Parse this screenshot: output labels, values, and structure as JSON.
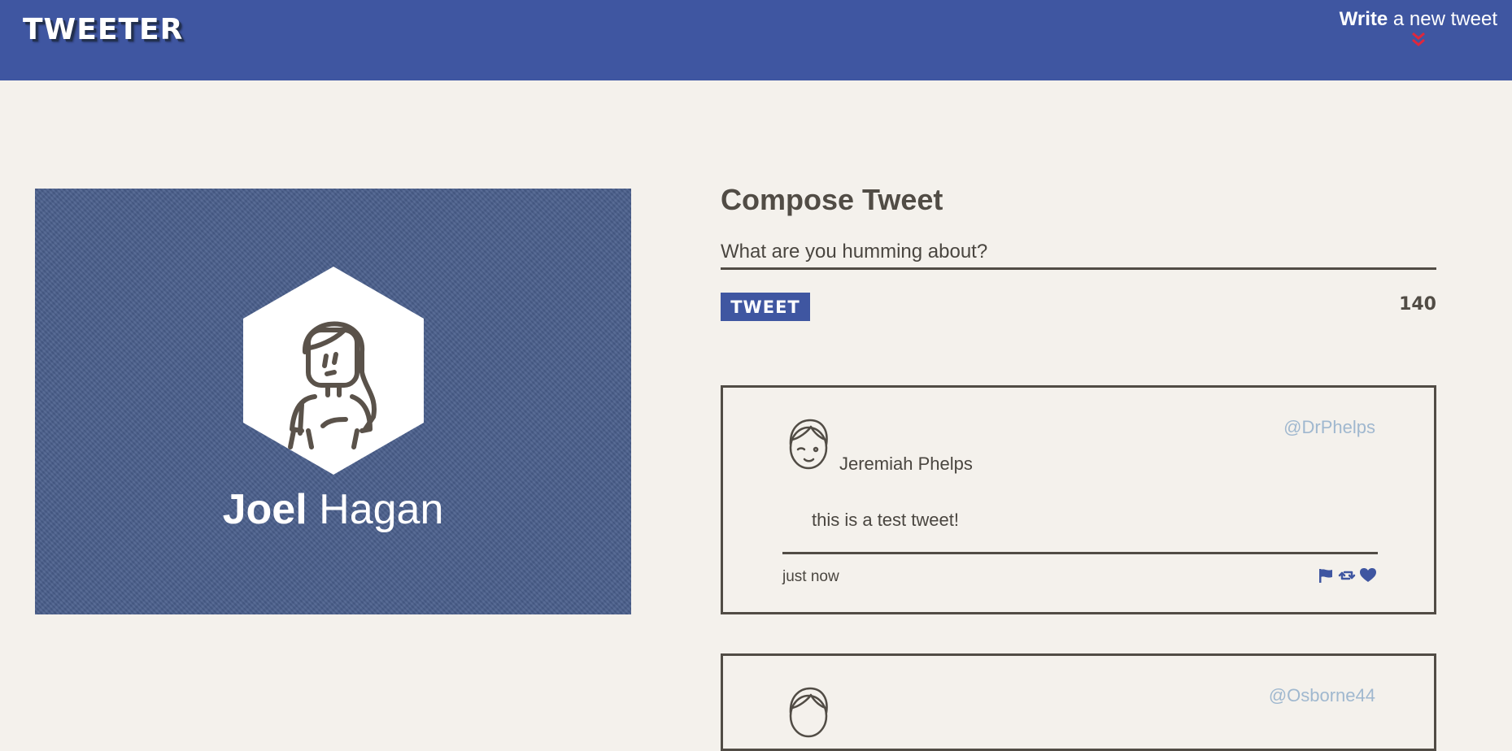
{
  "nav": {
    "logo": "TWEETER",
    "compose_toggle": {
      "bold": "Write",
      "light": " a new tweet",
      "arrow_icon": "double-chevron-down-icon",
      "arrow_color": "#e0273c"
    }
  },
  "profile": {
    "first_name": "Joel",
    "last_name": "Hagan",
    "avatar_icon": "woman-avatar-icon"
  },
  "compose": {
    "title": "Compose Tweet",
    "placeholder": "What are you humming about?",
    "button_label": "TWEET",
    "counter": "140"
  },
  "tweets": [
    {
      "handle": "@DrPhelps",
      "name": "Jeremiah Phelps",
      "body": "this is a test tweet!",
      "time": "just now",
      "avatar_icon": "winking-face-avatar-icon",
      "actions": [
        "flag-icon",
        "retweet-icon",
        "heart-icon"
      ]
    },
    {
      "handle": "@Osborne44",
      "avatar_icon": "face-avatar-icon"
    }
  ],
  "colors": {
    "nav_bg": "#3f56a1",
    "page_bg": "#f4f1ec",
    "text": "#514c45",
    "handle": "#a0b8cf",
    "accent": "#3f56a1",
    "profile_bg": "#4a5f8c"
  }
}
